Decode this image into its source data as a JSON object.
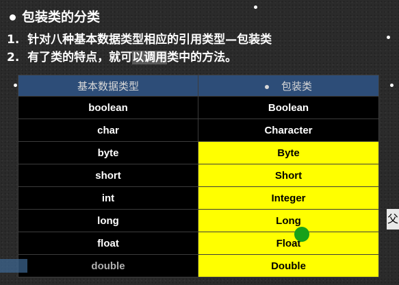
{
  "title": "包装类的分类",
  "points": [
    {
      "num": "1.",
      "text_a": "针对八种基本数据类型相应的引用类型—包装类",
      "hl": "",
      "text_b": ""
    },
    {
      "num": "2.",
      "text_a": "有了类的特点，就可",
      "hl": "以调用",
      "text_b": "类中的方法。"
    }
  ],
  "table": {
    "headers": [
      "基本数据类型",
      "包装类"
    ],
    "rows": [
      {
        "primitive": "boolean",
        "wrapper": "Boolean",
        "highlight": false
      },
      {
        "primitive": "char",
        "wrapper": "Character",
        "highlight": false
      },
      {
        "primitive": "byte",
        "wrapper": "Byte",
        "highlight": true
      },
      {
        "primitive": "short",
        "wrapper": "Short",
        "highlight": true
      },
      {
        "primitive": "int",
        "wrapper": "Integer",
        "highlight": true
      },
      {
        "primitive": "long",
        "wrapper": "Long",
        "highlight": true
      },
      {
        "primitive": "float",
        "wrapper": "Float",
        "highlight": true
      },
      {
        "primitive": "double",
        "wrapper": "Double",
        "highlight": true
      }
    ]
  },
  "colors": {
    "header_bg": "#2d4d78",
    "highlight": "#ffff00",
    "cell_bg": "#000000"
  },
  "side_glyph": "父"
}
